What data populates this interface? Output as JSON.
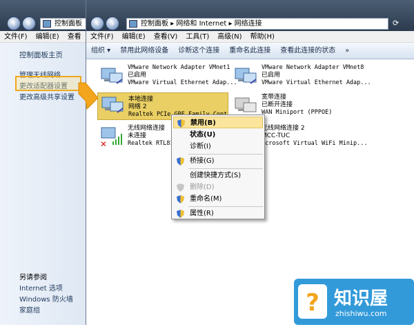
{
  "back_window": {
    "address": "控制面板",
    "menu": [
      "文件(F)",
      "编辑(E)",
      "查看"
    ],
    "side_links": [
      "控制面板主页",
      "管理无线网络",
      "更改适配器设置",
      "更改高级共享设置"
    ],
    "see_also": [
      "另请参阅",
      "Internet 选项",
      "Windows 防火墙",
      "家庭组"
    ]
  },
  "front_window": {
    "address": [
      "控制面板",
      "网络和 Internet",
      "网络连接"
    ],
    "menu": [
      "文件(F)",
      "编辑(E)",
      "查看(V)",
      "工具(T)",
      "高级(N)",
      "帮助(H)"
    ],
    "commands": [
      "组织",
      "禁用此网络设备",
      "诊断这个连接",
      "重命名此连接",
      "查看此连接的状态"
    ],
    "connections": [
      {
        "name": "VMware Network Adapter VMnet1",
        "status": "已启用",
        "device": "VMware Virtual Ethernet Adap..."
      },
      {
        "name": "VMware Network Adapter VMnet8",
        "status": "已启用",
        "device": "VMware Virtual Ethernet Adap..."
      },
      {
        "name": "本地连接",
        "status": "网络  2",
        "device": "Realtek PCIe GBE Family Cont..."
      },
      {
        "name": "宽带连接",
        "status": "已断开连接",
        "device": "WAN Miniport (PPPOE)"
      },
      {
        "name": "无线网络连接",
        "status": "未连接",
        "device": "Realtek RTL819..."
      },
      {
        "name": "无线网络连接 2",
        "status": "MCC-TUC",
        "device": "icrosoft Virtual WiFi Minip..."
      }
    ]
  },
  "context_menu": {
    "items": [
      "禁用(B)",
      "状态(U)",
      "诊断(I)",
      "桥接(G)",
      "创建快捷方式(S)",
      "删除(D)",
      "重命名(M)",
      "属性(R)"
    ]
  },
  "watermark": {
    "brand": "知识屋",
    "url": "zhishiwu.com"
  },
  "colors": {
    "highlight_box": "#f0a81a",
    "selection": "#e9cf64",
    "menu_hot": "#fbe59d",
    "logo_bg": "#1d8fd6"
  }
}
